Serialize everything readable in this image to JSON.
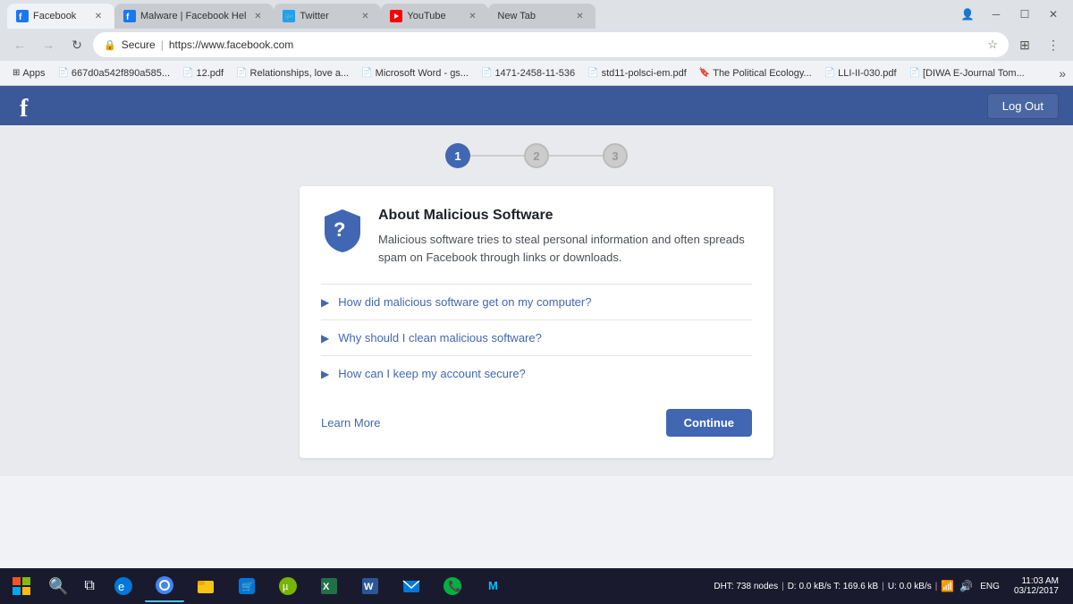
{
  "browser": {
    "tabs": [
      {
        "id": "tab-facebook",
        "title": "Facebook",
        "active": true,
        "favicon": "fb"
      },
      {
        "id": "tab-malware",
        "title": "Malware | Facebook Hel",
        "active": false,
        "favicon": "fb"
      },
      {
        "id": "tab-twitter",
        "title": "Twitter",
        "active": false,
        "favicon": "tw"
      },
      {
        "id": "tab-youtube",
        "title": "YouTube",
        "active": false,
        "favicon": "yt"
      },
      {
        "id": "tab-new",
        "title": "New Tab",
        "active": false,
        "favicon": ""
      }
    ],
    "address": "https://www.facebook.com",
    "secure_label": "Secure",
    "secure_prefix": "| "
  },
  "bookmarks": {
    "items": [
      {
        "label": "Apps",
        "icon": "⊞"
      },
      {
        "label": "667d0a542f890a585...",
        "icon": "📄"
      },
      {
        "label": "12.pdf",
        "icon": "📄"
      },
      {
        "label": "Relationships, love a...",
        "icon": "📄"
      },
      {
        "label": "Microsoft Word - gs...",
        "icon": "📄"
      },
      {
        "label": "1471-2458-11-536",
        "icon": "📄"
      },
      {
        "label": "std11-polsci-em.pdf",
        "icon": "📄"
      },
      {
        "label": "The Political Ecology...",
        "icon": "🔖"
      },
      {
        "label": "LLI-II-030.pdf",
        "icon": "📄"
      },
      {
        "label": "[DIWA E-Journal Tom...",
        "icon": "📄"
      }
    ]
  },
  "facebook": {
    "logout_label": "Log Out"
  },
  "steps": [
    {
      "number": "1",
      "active": true
    },
    {
      "number": "2",
      "active": false
    },
    {
      "number": "3",
      "active": false
    }
  ],
  "card": {
    "title": "About Malicious Software",
    "description": "Malicious software tries to steal personal information and often spreads spam on Facebook through links or downloads.",
    "faq_items": [
      {
        "text": "How did malicious software get on my computer?"
      },
      {
        "text": "Why should I clean malicious software?"
      },
      {
        "text": "How can I keep my account secure?"
      }
    ],
    "learn_more_label": "Learn More",
    "continue_label": "Continue"
  },
  "taskbar": {
    "start_icon": "⊞",
    "search_icon": "🔍",
    "apps": [
      {
        "icon": "🗔",
        "active": false
      },
      {
        "icon": "🌐",
        "active": true
      },
      {
        "icon": "📁",
        "active": false
      },
      {
        "icon": "🛒",
        "active": false
      },
      {
        "icon": "🌀",
        "active": false
      },
      {
        "icon": "📊",
        "active": false
      },
      {
        "icon": "📝",
        "active": false
      },
      {
        "icon": "✉",
        "active": false
      },
      {
        "icon": "📞",
        "active": false
      },
      {
        "icon": "Ⓜ",
        "active": false
      }
    ],
    "dht_label": "DHT: 738 nodes",
    "transfer_label": "D: 0.0 kB/s T: 169.6 kB",
    "upload_label": "U: 0.0 kB/s",
    "sys_icons": [
      "📶",
      "🔊"
    ],
    "lang": "ENG",
    "time": "11:03 AM",
    "date": "03/12/2017"
  }
}
